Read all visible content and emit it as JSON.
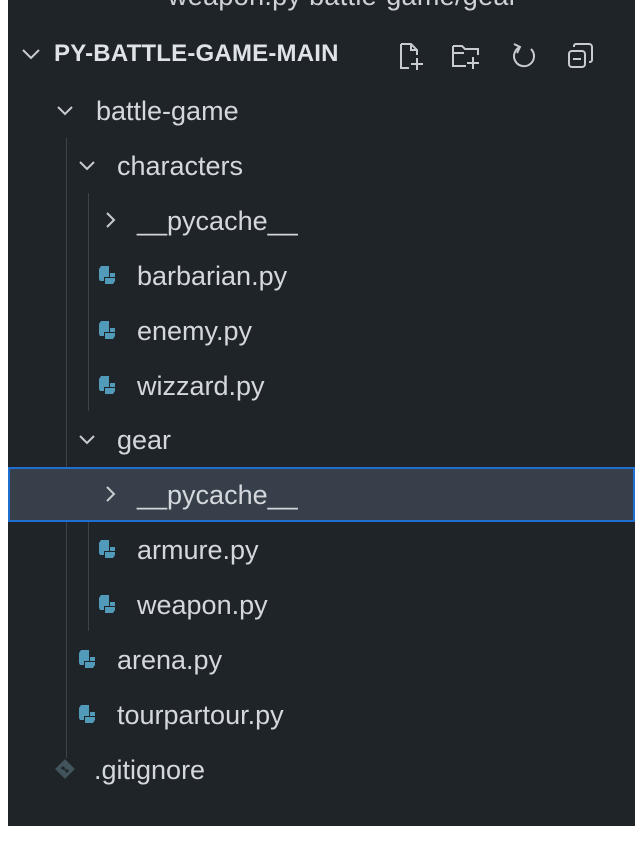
{
  "explorer": {
    "cut_top_text": "weapon.py battle-game/gear",
    "root": {
      "title": "PY-BATTLE-GAME-MAIN",
      "actions": [
        {
          "name": "new-file-icon"
        },
        {
          "name": "new-folder-icon"
        },
        {
          "name": "refresh-icon"
        },
        {
          "name": "collapse-all-icon"
        }
      ]
    },
    "tree": [
      {
        "label": "battle-game",
        "type": "folder",
        "expanded": true
      },
      {
        "label": "characters",
        "type": "folder",
        "expanded": true
      },
      {
        "label": "__pycache__",
        "type": "folder",
        "expanded": false
      },
      {
        "label": "barbarian.py",
        "type": "python"
      },
      {
        "label": "enemy.py",
        "type": "python"
      },
      {
        "label": "wizzard.py",
        "type": "python"
      },
      {
        "label": "gear",
        "type": "folder",
        "expanded": true
      },
      {
        "label": "__pycache__",
        "type": "folder",
        "expanded": false,
        "selected": true
      },
      {
        "label": "armure.py",
        "type": "python"
      },
      {
        "label": "weapon.py",
        "type": "python"
      },
      {
        "label": "arena.py",
        "type": "python"
      },
      {
        "label": "tourpartour.py",
        "type": "python"
      },
      {
        "label": ".gitignore",
        "type": "git"
      }
    ]
  },
  "colors": {
    "background": "#1f2428",
    "selection": "#37404a",
    "focus_border": "#1f6fd1",
    "python_icon": "#519aba",
    "text": "#d4d8dc"
  }
}
